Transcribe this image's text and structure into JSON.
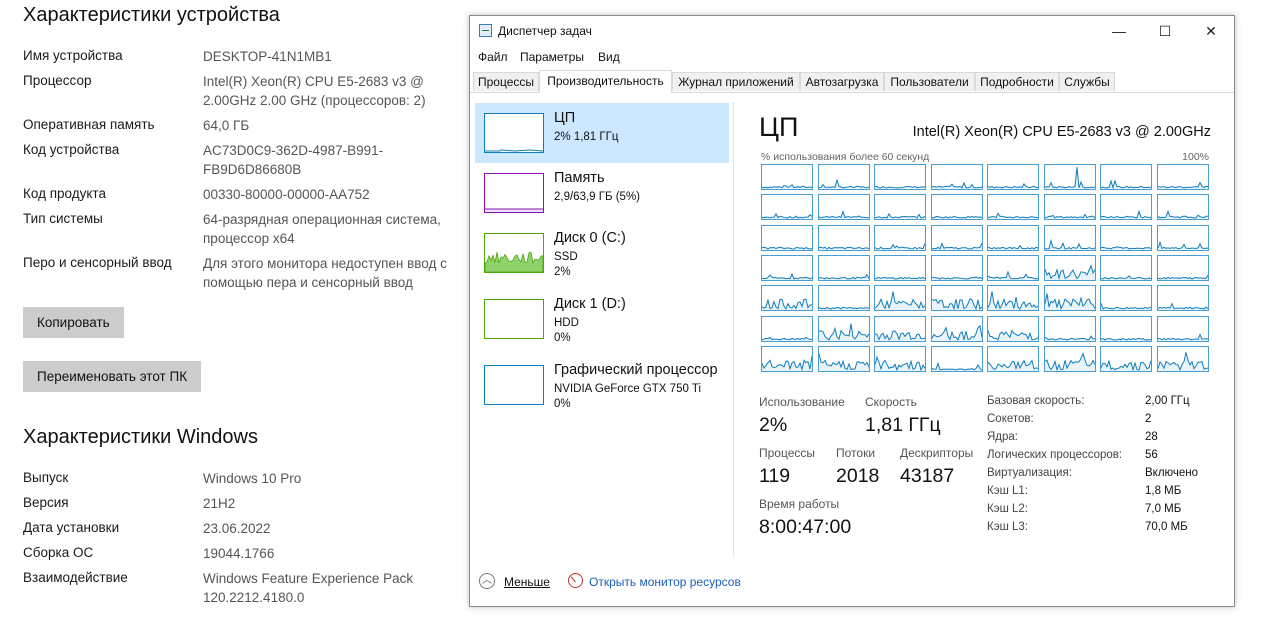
{
  "settings": {
    "device_section_title": "Характеристики устройства",
    "device_rows": [
      {
        "label": "Имя устройства",
        "value": "DESKTOP-41N1MB1"
      },
      {
        "label": "Процессор",
        "value": "Intel(R) Xeon(R) CPU E5-2683 v3 @\n2.00GHz   2.00 GHz (процессоров: 2)"
      },
      {
        "label": "Оперативная память",
        "value": "64,0 ГБ"
      },
      {
        "label": "Код устройства",
        "value": "AC73D0C9-362D-4987-B991-\nFB9D6D86680B"
      },
      {
        "label": "Код продукта",
        "value": "00330-80000-00000-AA752"
      },
      {
        "label": "Тип системы",
        "value": "64-разрядная операционная система,\nпроцессор x64"
      },
      {
        "label": "Перо и сенсорный ввод",
        "value": "Для этого монитора недоступен ввод с\nпомощью пера и сенсорный ввод"
      }
    ],
    "copy_button": "Копировать",
    "rename_button": "Переименовать этот ПК",
    "windows_section_title": "Характеристики Windows",
    "windows_rows": [
      {
        "label": "Выпуск",
        "value": "Windows 10 Pro"
      },
      {
        "label": "Версия",
        "value": "21H2"
      },
      {
        "label": "Дата установки",
        "value": "23.06.2022"
      },
      {
        "label": "Сборка ОС",
        "value": "19044.1766"
      },
      {
        "label": "Взаимодействие",
        "value": "Windows Feature Experience Pack\n120.2212.4180.0"
      }
    ]
  },
  "taskmgr": {
    "title": "Диспетчер задач",
    "window_buttons": {
      "minimize": "—",
      "maximize": "☐",
      "close": "✕"
    },
    "menu": [
      "Файл",
      "Параметры",
      "Вид"
    ],
    "tabs": [
      "Процессы",
      "Производительность",
      "Журнал приложений",
      "Автозагрузка",
      "Пользователи",
      "Подробности",
      "Службы"
    ],
    "active_tab": "Производительность",
    "resources": [
      {
        "name": "ЦП",
        "line1": "2% 1,81 ГГц",
        "line2": "",
        "color": "#117dbb",
        "selected": true
      },
      {
        "name": "Память",
        "line1": "2,9/63,9 ГБ (5%)",
        "line2": "",
        "color": "#8b12ae",
        "selected": false
      },
      {
        "name": "Диск 0 (C:)",
        "line1": "SSD",
        "line2": "2%",
        "color": "#4da60c",
        "selected": false
      },
      {
        "name": "Диск 1 (D:)",
        "line1": "HDD",
        "line2": "0%",
        "color": "#4da60c",
        "selected": false
      },
      {
        "name": "Графический процессор",
        "line1": "NVIDIA GeForce GTX 750 Ti",
        "line2": "0%",
        "color": "#117dbb",
        "selected": false
      }
    ],
    "cpu": {
      "heading": "ЦП",
      "model": "Intel(R) Xeon(R) CPU E5-2683 v3 @ 2.00GHz",
      "graph_label_left": "% использования более 60 секунд",
      "graph_label_right": "100%",
      "logical_processors_shown": 56,
      "stats": {
        "utilization_label": "Использование",
        "utilization": "2%",
        "speed_label": "Скорость",
        "speed": "1,81 ГГц",
        "processes_label": "Процессы",
        "processes": "119",
        "threads_label": "Потоки",
        "threads": "2018",
        "handles_label": "Дескрипторы",
        "handles": "43187",
        "uptime_label": "Время работы",
        "uptime": "8:00:47:00"
      },
      "specs": [
        {
          "label": "Базовая скорость:",
          "value": "2,00 ГГц"
        },
        {
          "label": "Сокетов:",
          "value": "2"
        },
        {
          "label": "Ядра:",
          "value": "28"
        },
        {
          "label": "Логических процессоров:",
          "value": "56"
        },
        {
          "label": "Виртуализация:",
          "value": "Включено"
        },
        {
          "label": "Кэш L1:",
          "value": "1,8 МБ"
        },
        {
          "label": "Кэш L2:",
          "value": "7,0 МБ"
        },
        {
          "label": "Кэш L3:",
          "value": "70,0 МБ"
        }
      ]
    },
    "footer": {
      "less": "Меньше",
      "monitor_link": "Открыть монитор ресурсов"
    },
    "colors": {
      "cpu_line": "#117dbb",
      "selection": "#cce8ff",
      "link": "#1a5fb4"
    }
  }
}
